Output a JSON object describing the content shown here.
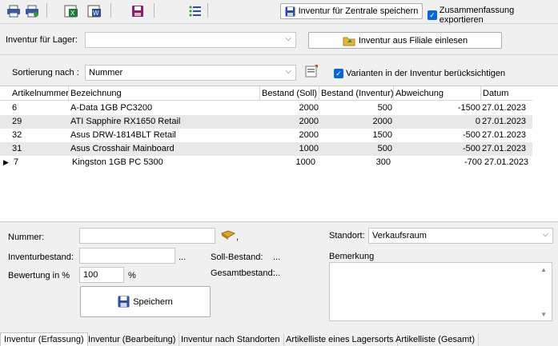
{
  "toolbar": {
    "save_central_label": "Inventur für Zentrale speichern",
    "export_summary_label": "Zusammenfassung exportieren",
    "export_summary_checked": true
  },
  "lager": {
    "label": "Inventur für Lager:",
    "value": "",
    "import_button_label": "Inventur aus Filiale einlesen"
  },
  "sort": {
    "label": "Sortierung nach :",
    "value": "Nummer",
    "variants_label": "Varianten in der Inventur berücksichtigen",
    "variants_checked": true
  },
  "grid": {
    "columns": [
      "Artikelnummer",
      "Bezeichnung",
      "Bestand (Soll)",
      "Bestand (Inventur)",
      "Abweichung",
      "Datum"
    ],
    "rows": [
      {
        "nr": "6",
        "bez": "A-Data 1GB PC3200",
        "soll": "2000",
        "inv": "500",
        "abw": "-1500",
        "datum": "27.01.2023"
      },
      {
        "nr": "29",
        "bez": "ATI Sapphire RX1650 Retail",
        "soll": "2000",
        "inv": "2000",
        "abw": "0",
        "datum": "27.01.2023"
      },
      {
        "nr": "32",
        "bez": "Asus DRW-1814BLT Retail",
        "soll": "2000",
        "inv": "1500",
        "abw": "-500",
        "datum": "27.01.2023"
      },
      {
        "nr": "31",
        "bez": "Asus Crosshair Mainboard",
        "soll": "1000",
        "inv": "500",
        "abw": "-500",
        "datum": "27.01.2023"
      },
      {
        "nr": "7",
        "bez": "Kingston 1GB PC 5300",
        "soll": "1000",
        "inv": "300",
        "abw": "-700",
        "datum": "27.01.2023"
      }
    ],
    "current_row_marker": "▶"
  },
  "form": {
    "nummer_label": "Nummer:",
    "nummer_value": "",
    "nummer_suffix": ",",
    "inventurbestand_label": "Inventurbestand:",
    "inventurbestand_value": "",
    "ellipsis": "...",
    "soll_label": "Soll-Bestand:",
    "soll_value": "...",
    "gesamt_label": "Gesamtbestand:",
    "gesamt_value": "...",
    "bewertung_label": "Bewertung in %",
    "bewertung_value": "100",
    "bewertung_unit": "%",
    "save_label": "Speichern",
    "standort_label": "Standort:",
    "standort_value": "Verkaufsraum",
    "bemerkung_label": "Bemerkung",
    "bemerkung_value": ""
  },
  "tabs": [
    {
      "label": "Inventur (Erfassung)",
      "active": true
    },
    {
      "label": "Inventur (Bearbeitung)",
      "active": false
    },
    {
      "label": "Inventur nach Standorten",
      "active": false
    },
    {
      "label": "Artikelliste eines Lagersorts",
      "active": false
    },
    {
      "label": "Artikelliste (Gesamt)",
      "active": false
    }
  ],
  "colors": {
    "accent": "#0a66d6",
    "row_alt": "#e8e8e8",
    "window_bg": "#f0f0f0"
  }
}
